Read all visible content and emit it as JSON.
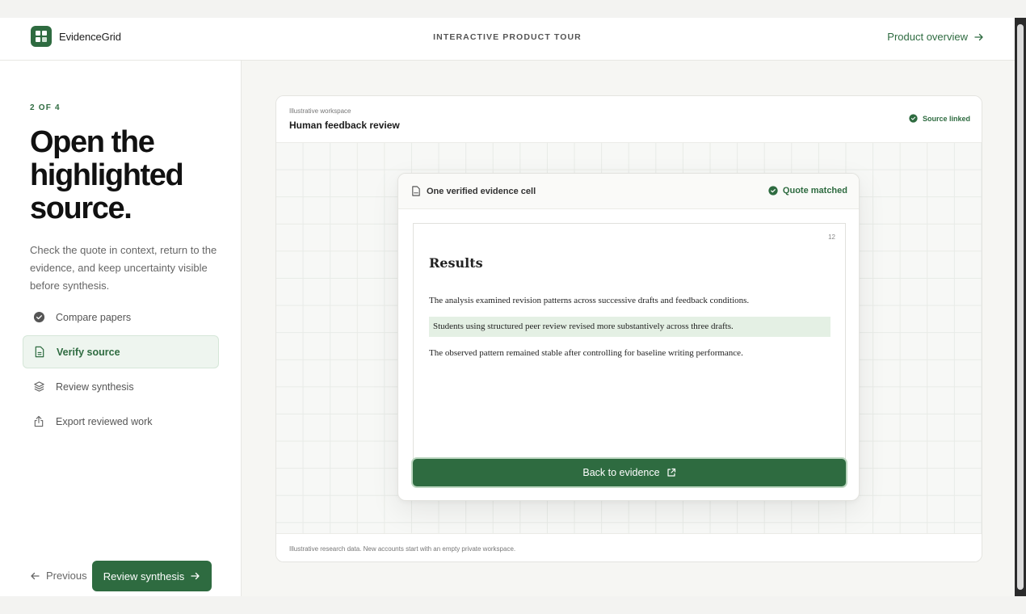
{
  "header": {
    "brand": "EvidenceGrid",
    "tour_label": "INTERACTIVE PRODUCT TOUR",
    "overview_link": "Product overview"
  },
  "sidebar": {
    "step_count": "2 OF 4",
    "headline": "Open the highlighted source.",
    "description": "Check the quote in context, return to the evidence, and keep uncertainty visible before synthesis.",
    "steps": [
      {
        "label": "Compare papers",
        "icon": "check-circle-icon",
        "state": "done"
      },
      {
        "label": "Verify source",
        "icon": "document-icon",
        "state": "active"
      },
      {
        "label": "Review synthesis",
        "icon": "layers-icon",
        "state": "upcoming"
      },
      {
        "label": "Export reviewed work",
        "icon": "share-icon",
        "state": "upcoming"
      }
    ],
    "previous_label": "Previous",
    "next_label": "Review synthesis"
  },
  "workspace": {
    "subtitle": "Illustrative workspace",
    "title": "Human feedback review",
    "badge": "Source linked",
    "footer": "Illustrative research data. New accounts start with an empty private workspace."
  },
  "card": {
    "title": "One verified evidence cell",
    "badge": "Quote matched",
    "page_number": "12",
    "heading": "Results",
    "paragraphs": [
      "The analysis examined revision patterns across successive drafts and feedback conditions.",
      "Students using structured peer review revised more substantively across three drafts.",
      "The observed pattern remained stable after controlling for baseline writing performance."
    ],
    "back_button": "Back to evidence"
  },
  "colors": {
    "accent": "#2e6b40",
    "highlight": "#e4f0e4",
    "active_bg": "#eef5ef"
  }
}
